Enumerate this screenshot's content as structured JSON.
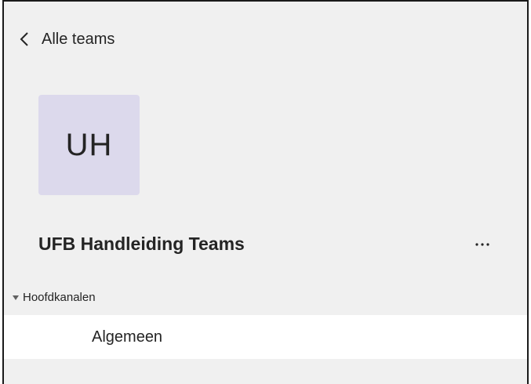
{
  "navigation": {
    "back_label": "Alle teams",
    "back_icon": "chevron-left-icon"
  },
  "team": {
    "initials": "UH",
    "name": "UFB Handleiding Teams",
    "more_label": "...",
    "avatar_color": "#dcd9ec"
  },
  "channels": {
    "group_label": "Hoofdkanalen",
    "items": [
      {
        "label": "Algemeen"
      }
    ]
  },
  "colors": {
    "panel_background": "#f0f0f0",
    "selected_row": "#ffffff",
    "text": "#242424"
  }
}
